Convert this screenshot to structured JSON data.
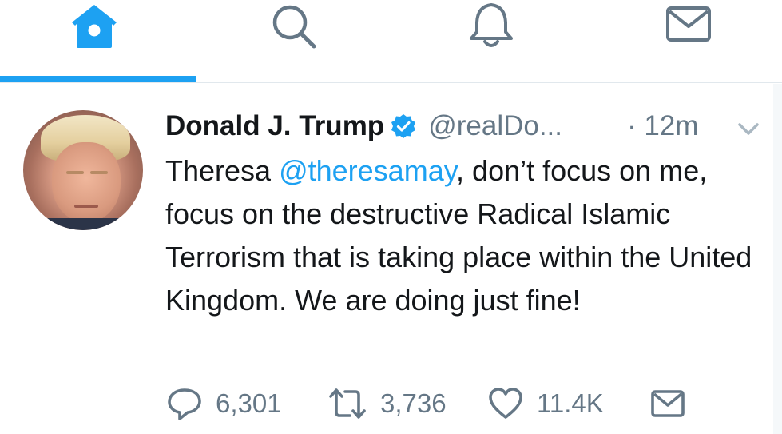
{
  "nav": {
    "tabs": [
      {
        "icon": "home-icon",
        "active": true
      },
      {
        "icon": "search-icon",
        "active": false
      },
      {
        "icon": "notifications-icon",
        "active": false
      },
      {
        "icon": "messages-icon",
        "active": false
      }
    ],
    "accent": "#1da1f2"
  },
  "tweet": {
    "author_name": "Donald J. Trump",
    "handle": "@realDo...",
    "verified": true,
    "time": "· 12m",
    "text_before_mention": "Theresa ",
    "mention": "@theresamay",
    "text_after_mention": ", don’t focus on me, focus on the destructive Radical Islamic Terrorism that is taking place within the United Kingdom. We are doing just fine!",
    "actions": {
      "replies": "6,301",
      "retweets": "3,736",
      "likes": "11.4K"
    }
  },
  "colors": {
    "text": "#14171a",
    "secondary": "#657786",
    "link": "#1da1f2"
  }
}
